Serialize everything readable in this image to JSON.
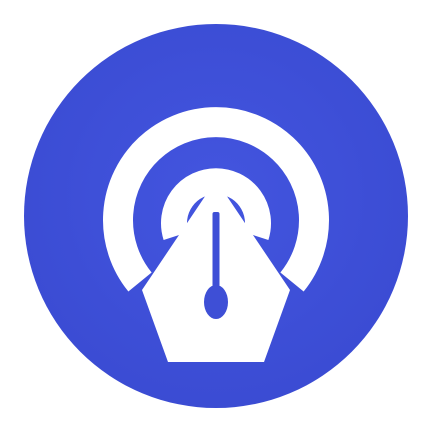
{
  "icon": {
    "name": "podcast-pen-app-icon",
    "background_color": "#3E4FD6",
    "foreground_color": "#FFFFFF"
  }
}
